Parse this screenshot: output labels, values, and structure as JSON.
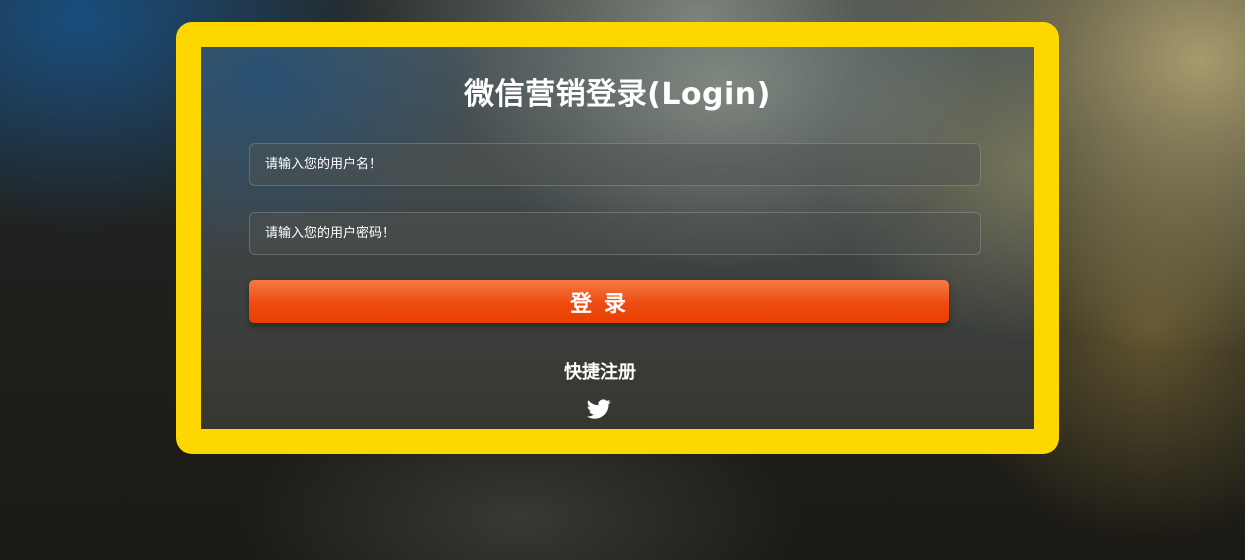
{
  "login": {
    "title": "微信营销登录(Login)",
    "username_placeholder": "请输入您的用户名！",
    "password_placeholder": "请输入您的用户密码！",
    "button_label": "登  录",
    "register_link": "快捷注册",
    "social_icon": "twitter-icon"
  },
  "colors": {
    "frame": "#ffd700",
    "button": "#ee4b10",
    "text": "#ffffff"
  }
}
